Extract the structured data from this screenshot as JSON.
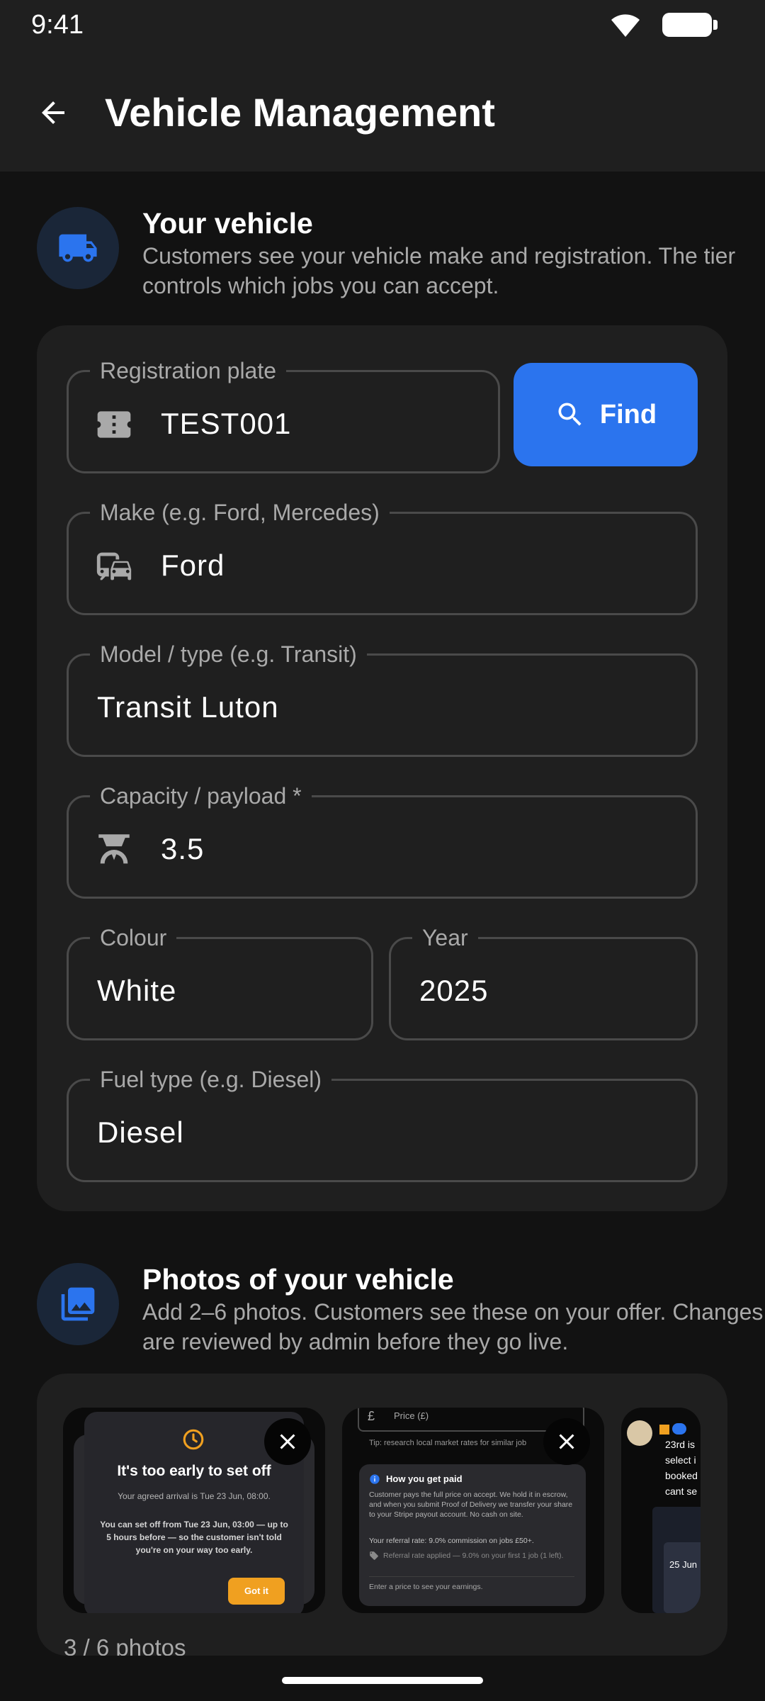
{
  "status_bar": {
    "time": "9:41"
  },
  "app_bar": {
    "title": "Vehicle Management"
  },
  "vehicle_section": {
    "title": "Your vehicle",
    "description": "Customers see your vehicle make and registration. The tier controls which jobs you can accept.",
    "fields": {
      "registration": {
        "label": "Registration plate",
        "value": "TEST001"
      },
      "find_button": "Find",
      "make": {
        "label": "Make (e.g. Ford, Mercedes)",
        "value": "Ford"
      },
      "model": {
        "label": "Model / type (e.g. Transit)",
        "value": "Transit Luton"
      },
      "capacity": {
        "label": "Capacity / payload *",
        "value": "3.5"
      },
      "colour": {
        "label": "Colour",
        "value": "White"
      },
      "year": {
        "label": "Year",
        "value": "2025"
      },
      "fuel": {
        "label": "Fuel type (e.g. Diesel)",
        "value": "Diesel"
      }
    }
  },
  "photos_section": {
    "title": "Photos of your vehicle",
    "description": "Add 2–6 photos. Customers see these on your offer. Changes are reviewed by admin before they go live.",
    "count": "3 / 6 photos",
    "photo1": {
      "title": "It's too early to set off",
      "line1": "Your agreed arrival is Tue 23 Jun, 08:00.",
      "line2": "You can set off from Tue 23 Jun, 03:00 — up to 5 hours before — so the customer isn't told you're on your way too early.",
      "button": "Got it"
    },
    "photo2": {
      "field": "Price (£)",
      "tip": "Tip: research local market rates for similar job",
      "heading": "How you get paid",
      "body": "Customer pays the full price on accept. We hold it in escrow, and when you submit Proof of Delivery we transfer your share to your Stripe payout account. No cash on site.",
      "referral": "Your referral rate: 9.0% commission on jobs £50+.",
      "applied": "Referral rate applied — 9.0% on your first 1 job (1 left).",
      "footer": "Enter a price to see your earnings."
    },
    "photo3": {
      "lines": [
        "23rd is",
        "select i",
        "booked",
        "cant se"
      ],
      "date": "25 Jun"
    }
  },
  "colors": {
    "accent": "#2b74ee",
    "background": "#121212",
    "surface": "#1f1f1f",
    "warning": "#f0a020"
  }
}
